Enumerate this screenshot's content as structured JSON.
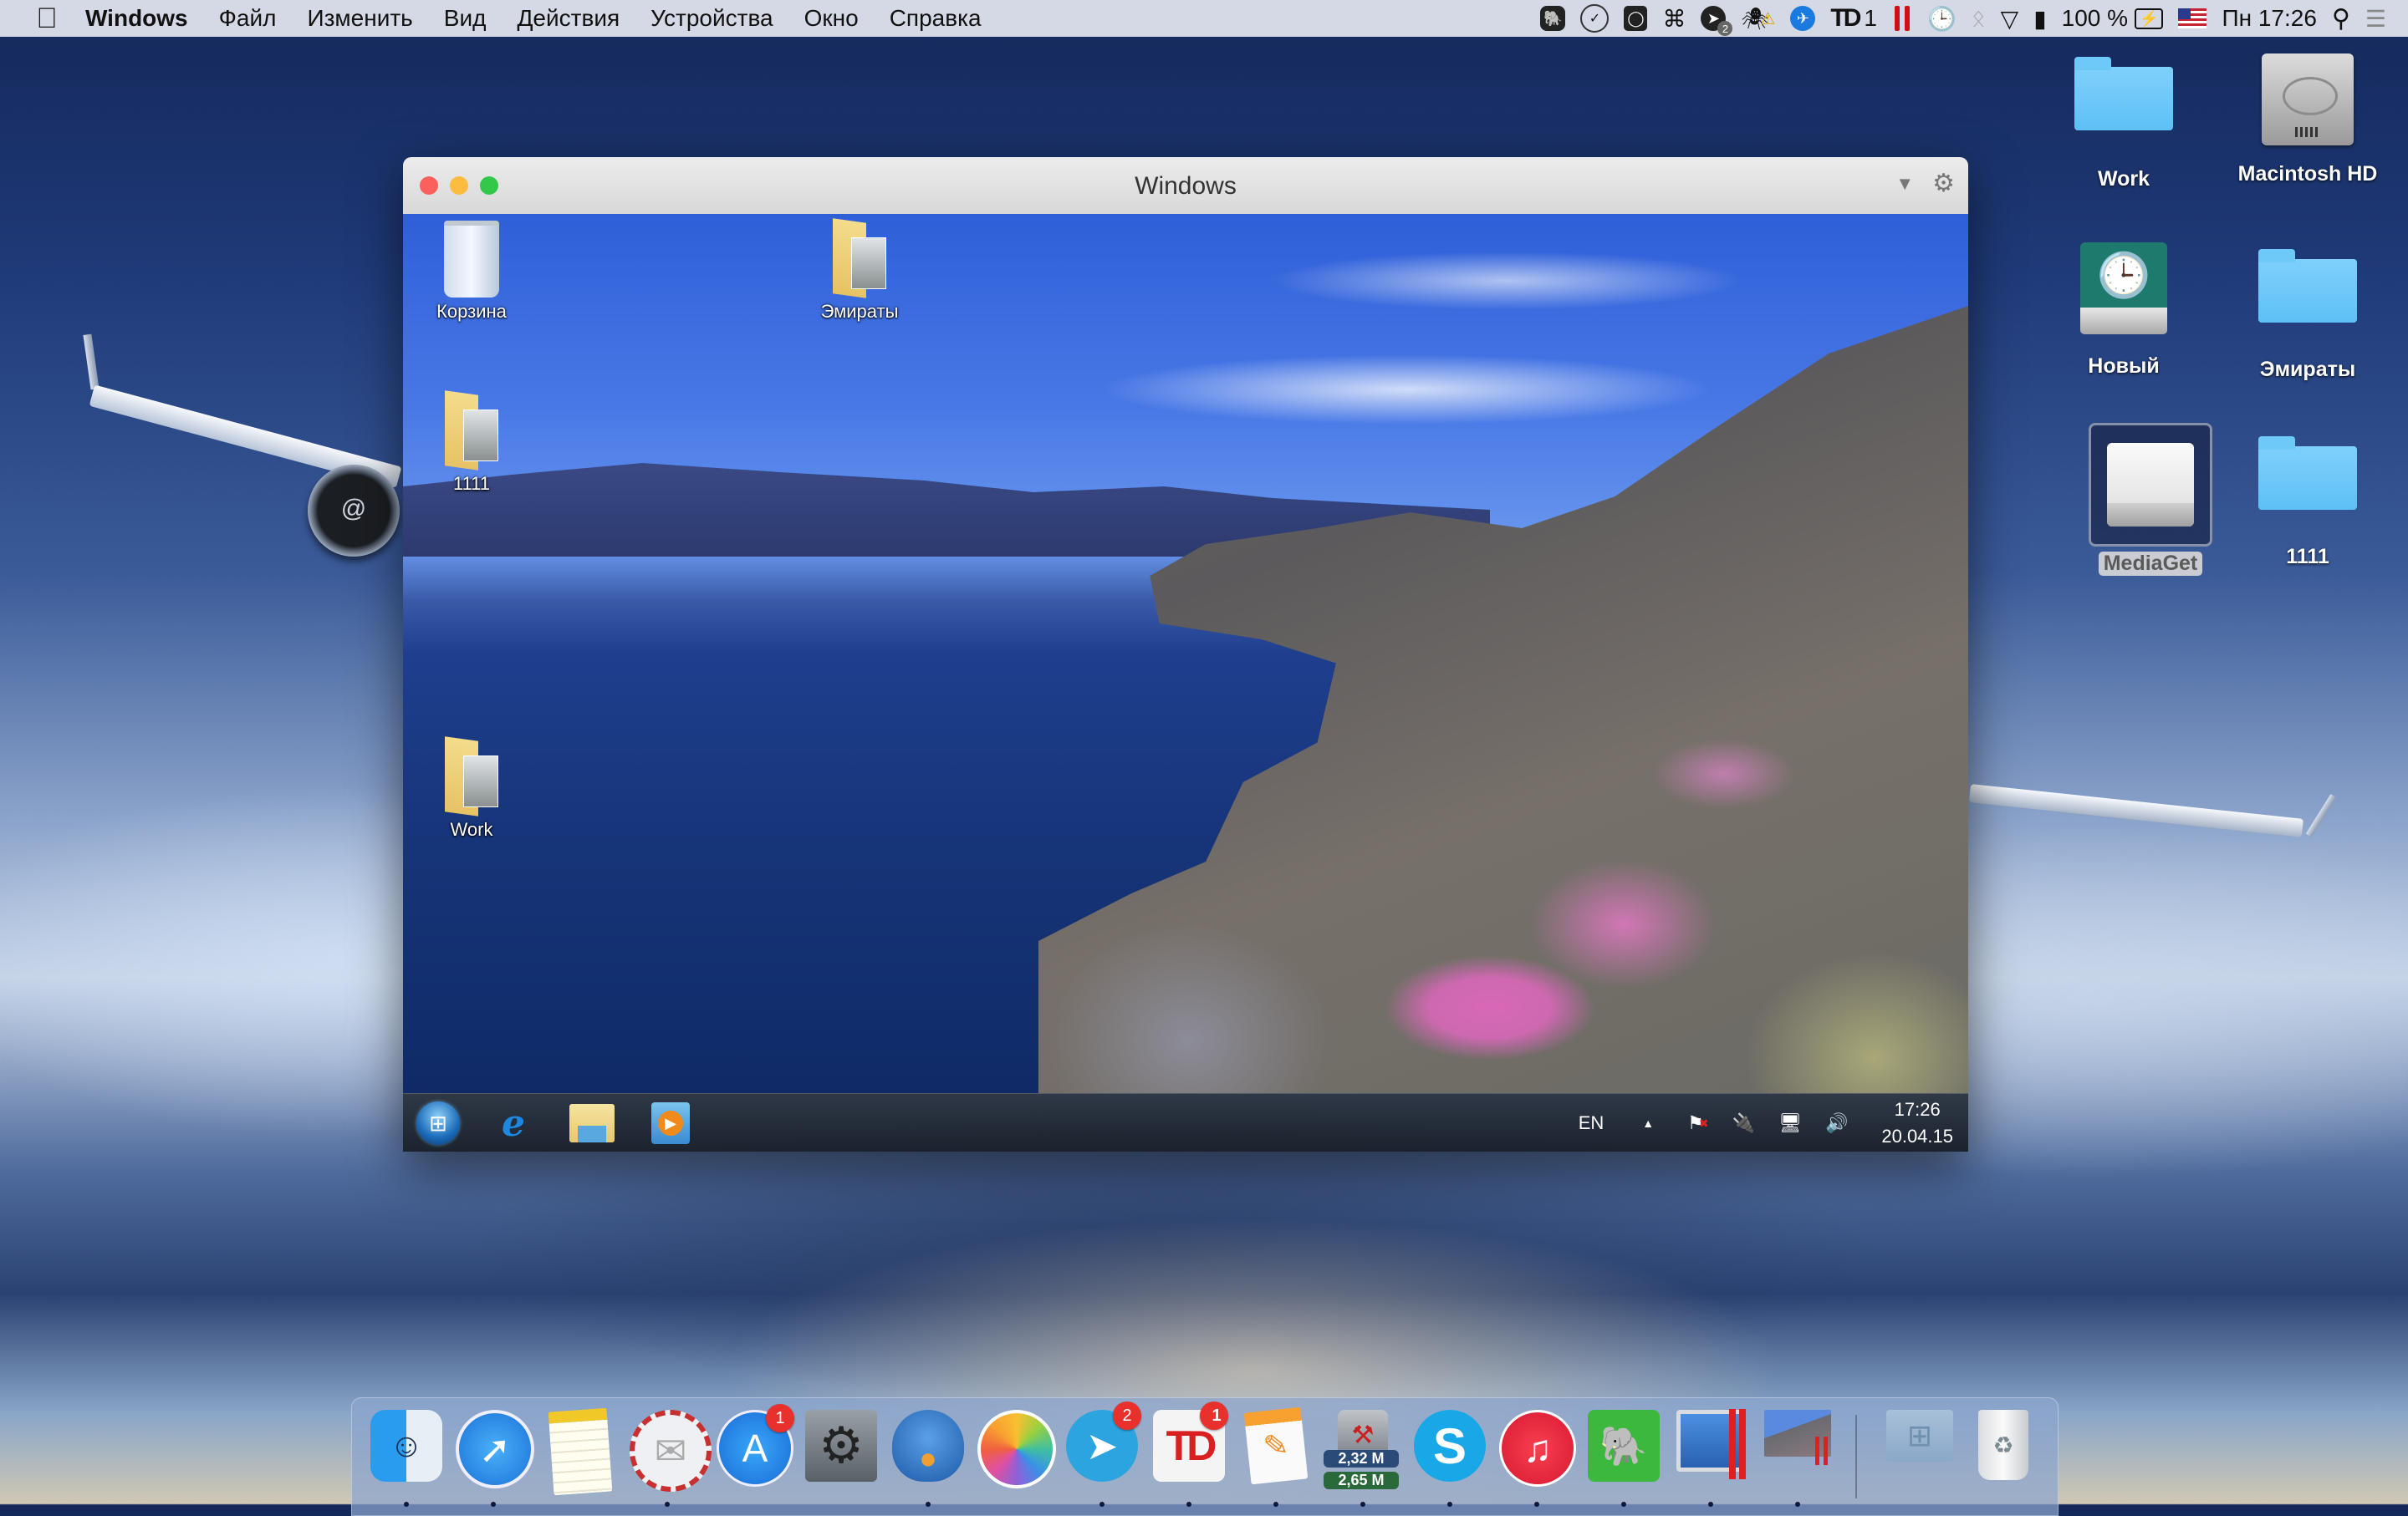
{
  "menubar": {
    "apple_icon": "apple-logo",
    "app_name": "Windows",
    "items": [
      "Файл",
      "Изменить",
      "Вид",
      "Действия",
      "Устройства",
      "Окно",
      "Справка"
    ],
    "status": {
      "telegram_badge": "2",
      "todoist_count": "1",
      "battery_percent": "100 %",
      "input_source": "US",
      "clock": "Пн 17:26"
    }
  },
  "vm_window": {
    "title": "Windows",
    "traffic_light_colors": {
      "close": "#fc605c",
      "minimize": "#fdbc40",
      "zoom": "#34c84a"
    },
    "desktop_icons": [
      {
        "label": "Корзина",
        "type": "recycle-bin"
      },
      {
        "label": "Эмираты",
        "type": "folder"
      },
      {
        "label": "1111",
        "type": "folder"
      },
      {
        "label": "Work",
        "type": "folder"
      }
    ],
    "taskbar": {
      "pinned": [
        "start",
        "internet-explorer",
        "windows-explorer",
        "windows-media-player"
      ],
      "language": "EN",
      "time": "17:26",
      "date": "20.04.15"
    }
  },
  "mac_desktop_icons": [
    {
      "label": "Work",
      "type": "folder"
    },
    {
      "label": "Macintosh HD",
      "type": "hard-drive"
    },
    {
      "label": "Новый",
      "type": "time-machine-drive"
    },
    {
      "label": "Эмираты",
      "type": "folder"
    },
    {
      "label": "MediaGet",
      "type": "external-drive",
      "selected": true
    },
    {
      "label": "1111",
      "type": "folder"
    }
  ],
  "dock": {
    "apps": [
      {
        "name": "Finder",
        "running": true
      },
      {
        "name": "Safari",
        "running": true
      },
      {
        "name": "Notes",
        "running": false
      },
      {
        "name": "Airmail",
        "running": true
      },
      {
        "name": "App Store",
        "running": false,
        "badge": "1"
      },
      {
        "name": "System Preferences",
        "running": false
      },
      {
        "name": "Tweetbot",
        "running": true
      },
      {
        "name": "Photos",
        "running": false
      },
      {
        "name": "Telegram",
        "running": true,
        "badge": "2"
      },
      {
        "name": "Todoist",
        "running": true,
        "badge": "1"
      },
      {
        "name": "Pages",
        "running": true
      },
      {
        "name": "Network Monitor",
        "running": true,
        "upload": "2,32 M",
        "download": "2,65 M"
      },
      {
        "name": "Skype",
        "running": true
      },
      {
        "name": "iTunes",
        "running": true
      },
      {
        "name": "Evernote",
        "running": true
      },
      {
        "name": "Parallels Desktop",
        "running": true
      },
      {
        "name": "Windows",
        "running": true
      }
    ],
    "stack_folder": "Windows Applications",
    "trash": "Trash"
  }
}
